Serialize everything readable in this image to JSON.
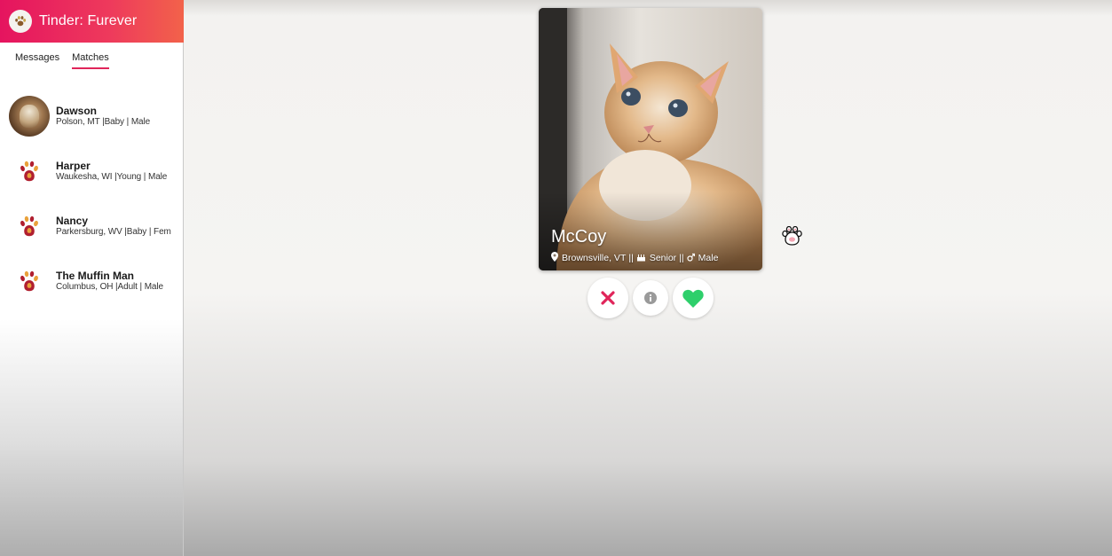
{
  "app": {
    "title": "Tinder: Furever",
    "logo_icon": "paw-icon"
  },
  "tabs": [
    {
      "label": "Messages",
      "active": false
    },
    {
      "label": "Matches",
      "active": true
    }
  ],
  "matches": [
    {
      "name": "Dawson",
      "meta": "Polson, MT |Baby | Male",
      "avatar": "dog-photo"
    },
    {
      "name": "Harper",
      "meta": "Waukesha, WI |Young | Male",
      "avatar": "paw-icon"
    },
    {
      "name": "Nancy",
      "meta": "Parkersburg, WV |Baby | Female",
      "avatar": "paw-icon"
    },
    {
      "name": "The Muffin Man",
      "meta": "Columbus, OH |Adult | Male",
      "avatar": "paw-icon"
    }
  ],
  "card": {
    "name": "McCoy",
    "location": "Brownsville, VT",
    "age": "Senior",
    "sex": "Male",
    "separator": "||",
    "icons": [
      "location-pin-icon",
      "cake-icon",
      "gender-icon"
    ]
  },
  "actions": {
    "dislike_icon": "close-icon",
    "info_icon": "info-icon",
    "like_icon": "heart-icon"
  },
  "colors": {
    "brand_start": "#e5145f",
    "brand_end": "#f2624a",
    "dislike": "#e0255a",
    "like": "#2ecf6b",
    "paw": "#b01f2f"
  }
}
